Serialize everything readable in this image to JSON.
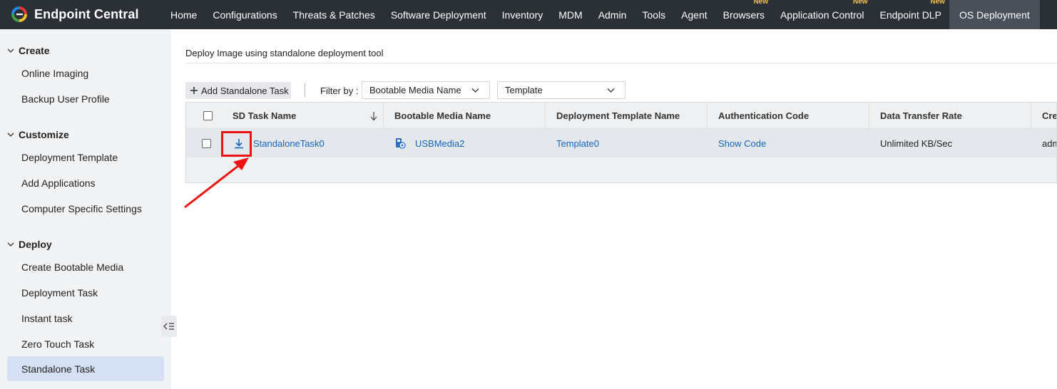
{
  "brand": {
    "name": "Endpoint Central"
  },
  "nav": [
    {
      "label": "Home"
    },
    {
      "label": "Configurations"
    },
    {
      "label": "Threats & Patches"
    },
    {
      "label": "Software Deployment"
    },
    {
      "label": "Inventory"
    },
    {
      "label": "MDM"
    },
    {
      "label": "Admin"
    },
    {
      "label": "Tools"
    },
    {
      "label": "Agent"
    },
    {
      "label": "Browsers",
      "badge": "New"
    },
    {
      "label": "Application Control",
      "badge": "New"
    },
    {
      "label": "Endpoint DLP",
      "badge": "New"
    },
    {
      "label": "OS Deployment",
      "active": true
    }
  ],
  "sidebar": {
    "sections": [
      {
        "title": "Create",
        "items": [
          "Online Imaging",
          "Backup User Profile"
        ]
      },
      {
        "title": "Customize",
        "items": [
          "Deployment Template",
          "Add Applications",
          "Computer Specific Settings"
        ]
      },
      {
        "title": "Deploy",
        "items": [
          "Create Bootable Media",
          "Deployment Task",
          "Instant task",
          "Zero Touch Task",
          "Standalone Task"
        ]
      }
    ],
    "active_item": "Standalone Task"
  },
  "main": {
    "title": "Deploy Image using standalone deployment tool",
    "add_button": "Add Standalone Task",
    "filter_label": "Filter by :",
    "filter_media": "Bootable Media Name",
    "filter_template": "Template"
  },
  "table": {
    "columns": [
      "SD Task Name",
      "Bootable Media Name",
      "Deployment Template Name",
      "Authentication Code",
      "Data Transfer Rate",
      "Cre"
    ],
    "rows": [
      {
        "task": "StandaloneTask0",
        "media": "USBMedia2",
        "template": "Template0",
        "auth": "Show Code",
        "rate": "Unlimited KB/Sec",
        "created": "adm"
      }
    ]
  },
  "colors": {
    "topbar": "#2b2f36",
    "accent_link": "#1565c0",
    "highlight": "#ee1111",
    "active_side": "#d6e0f5"
  }
}
